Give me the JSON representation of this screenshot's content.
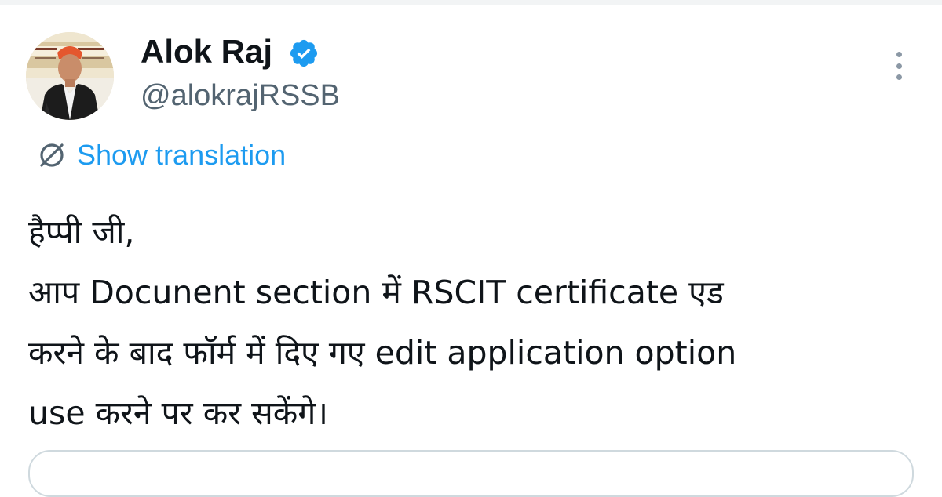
{
  "author": {
    "display_name": "Alok Raj",
    "handle": "@alokrajRSSB",
    "verified": true,
    "avatar_icon": "profile-photo"
  },
  "colors": {
    "link_blue": "#1d9bf0",
    "verified_blue": "#1d9bf0",
    "secondary_text": "#536471",
    "primary_text": "#0f1419"
  },
  "actions": {
    "more_icon": "more-vertical-icon",
    "translate_icon": "translate-icon",
    "show_translation_label": "Show translation"
  },
  "tweet": {
    "lines": [
      "हैप्पी जी,",
      "आप Docunent section में RSCIT certificate एड",
      "करने के बाद फॉर्म में दिए गए edit application option",
      "use करने पर कर सकेंगे।"
    ]
  }
}
